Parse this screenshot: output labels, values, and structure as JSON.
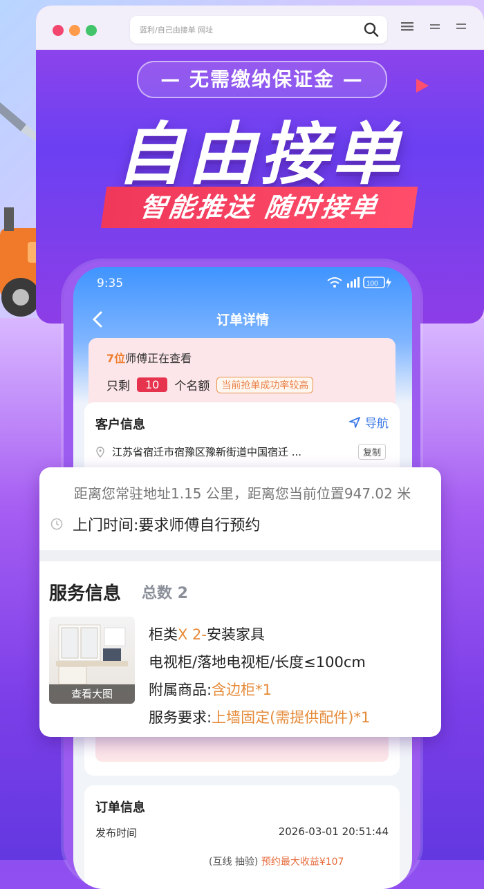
{
  "browser": {
    "url_text": "蓝利/自己由接单 网址",
    "window_dots": [
      "#f3466e",
      "#ff9b4a",
      "#42c46b"
    ]
  },
  "banner": {
    "pill": "— 无需缴纳保证金 —",
    "title": "自由接单",
    "subtitle": "智能推送 随时接单"
  },
  "status_bar": {
    "time": "9:35",
    "battery": "100"
  },
  "nav": {
    "title": "订单详情"
  },
  "notice": {
    "viewers_num": "7位",
    "viewers_text": "师傅正在查看",
    "remaining_prefix": "只剩",
    "remaining_count": "10",
    "remaining_suffix": "个名额",
    "rate_badge": "当前抢单成功率较高"
  },
  "customer": {
    "title": "客户信息",
    "nav_label": "导航",
    "address": "江苏省宿迁市宿豫区豫新街道中国宿迁 ...",
    "copy_label": "复制"
  },
  "detail": {
    "distance": "距离您常驻地址1.15 公里，距离您当前位置947.02 米",
    "visit_time": "上门时间:要求师傅自行预约",
    "service_title": "服务信息",
    "service_total": "总数  2",
    "image_caption": "查看大图",
    "item_name_prefix": "柜类",
    "item_qty": "X 2-",
    "item_name_suffix": "安装家具",
    "item_spec": "电视柜/落地电视柜/长度≤100cm",
    "accessory_label": "附属商品:",
    "accessory_value": "含边柜*1",
    "requirement_label": "服务要求:",
    "requirement_value": "上墙固定(需提供配件)*1"
  },
  "order": {
    "title": "订单信息",
    "publish_label": "发布时间",
    "publish_value": "2026-03-01 20:51:44",
    "extra_left": "(互线 抽验)",
    "extra_right": "预约最大收益¥107"
  },
  "colors": {
    "accent_blue": "#3a78e6",
    "accent_orange": "#e58a38",
    "badge_red": "#e6344f",
    "banner_red": "#f0385a"
  }
}
